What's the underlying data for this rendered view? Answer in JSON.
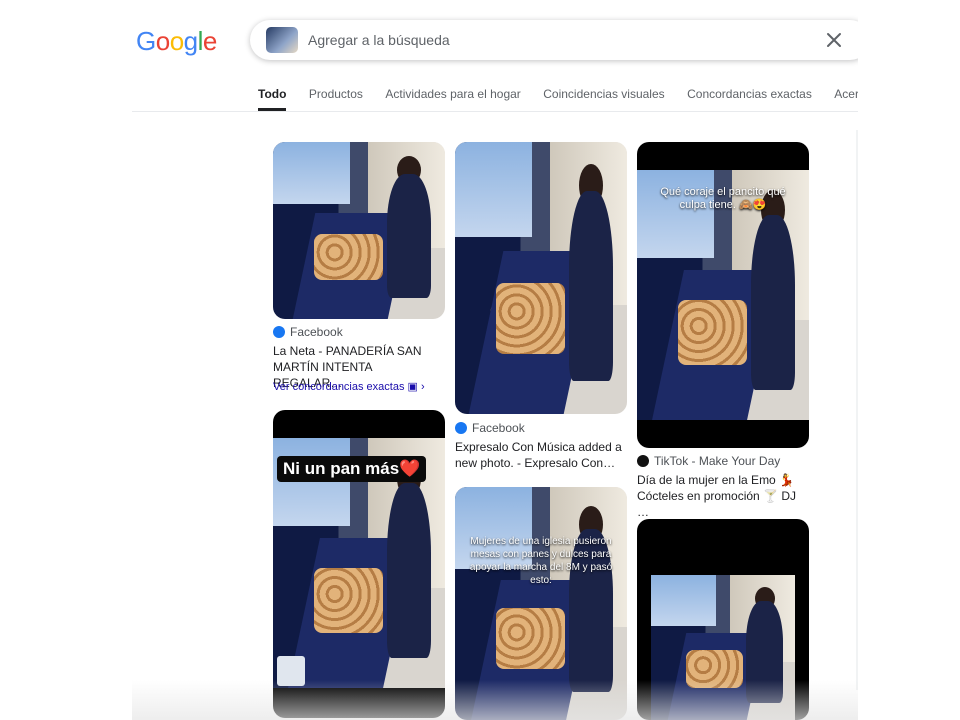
{
  "logo": "Google",
  "search": {
    "placeholder": "Agregar a la búsqueda",
    "close_icon": "close-icon"
  },
  "tabs": [
    {
      "label": "Todo",
      "active": true
    },
    {
      "label": "Productos"
    },
    {
      "label": "Actividades para el hogar"
    },
    {
      "label": "Coincidencias visuales"
    },
    {
      "label": "Concordancias exactas"
    },
    {
      "label": "Acerca d"
    }
  ],
  "results": [
    {
      "source": "Facebook",
      "title": "La Neta - PANADERÍA SAN MARTÍN INTENTA REGALAR…",
      "link": "Ver concordancias exactas"
    },
    {
      "source": "Facebook",
      "title": "Expresalo Con Música added a new photo. - Expresalo Con…"
    },
    {
      "source": "TikTok - Make Your Day",
      "title": "Día de la mujer en la Emo 💃 Cócteles en promoción 🍸 DJ …",
      "overlay": "Qué coraje el pancito qué culpa tiene. 🙈😍"
    },
    {
      "overlay": "Ni un pan más❤️"
    },
    {
      "overlay": "Mujeres de una iglesia pusieron mesas con panes y dulces para apoyar la marcha del 8M y pasó esto:"
    },
    {}
  ]
}
